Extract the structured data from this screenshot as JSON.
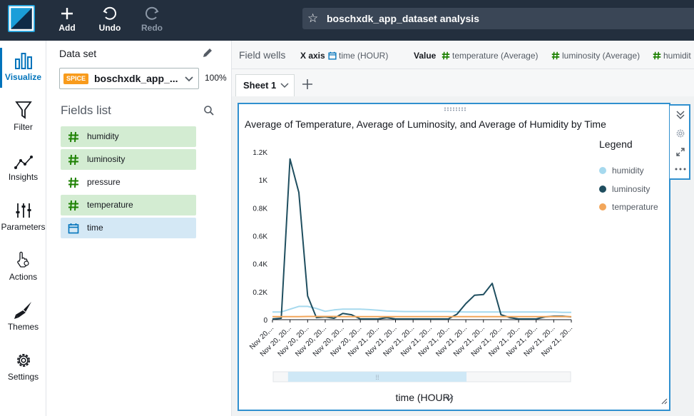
{
  "app": {
    "title": "boschxdk_app_dataset analysis",
    "toolbar": {
      "add": "Add",
      "undo": "Undo",
      "redo": "Redo"
    }
  },
  "rail": [
    {
      "label": "Visualize",
      "icon": "bar-chart-icon",
      "active": true
    },
    {
      "label": "Filter",
      "icon": "filter-icon"
    },
    {
      "label": "Insights",
      "icon": "insights-icon"
    },
    {
      "label": "Parameters",
      "icon": "sliders-icon"
    },
    {
      "label": "Actions",
      "icon": "pointer-gear-icon"
    },
    {
      "label": "Themes",
      "icon": "brush-icon"
    },
    {
      "label": "Settings",
      "icon": "gear-icon"
    }
  ],
  "panel": {
    "dataset_label": "Data set",
    "spice_badge": "SPICE",
    "dataset_name": "boschxdk_app_...",
    "dataset_pct": "100%",
    "fields_title": "Fields list",
    "fields": [
      {
        "name": "humidity",
        "type": "number",
        "selected": true
      },
      {
        "name": "luminosity",
        "type": "number",
        "selected": true
      },
      {
        "name": "pressure",
        "type": "number",
        "selected": false
      },
      {
        "name": "temperature",
        "type": "number",
        "selected": true
      },
      {
        "name": "time",
        "type": "date",
        "selected": true
      }
    ]
  },
  "wells": {
    "title": "Field wells",
    "x_label": "X axis",
    "x_value": "time (HOUR)",
    "value_label": "Value",
    "values": [
      "temperature (Average)",
      "luminosity (Average)",
      "humidit"
    ]
  },
  "sheets": {
    "active": "Sheet 1"
  },
  "visual": {
    "title": "Average of Temperature, Average of Luminosity, and Average of Humidity by Time",
    "legend_title": "Legend",
    "x_axis_title": "time (HOUR)"
  },
  "colors": {
    "topbar": "#232f3e",
    "accent": "#0073bb",
    "humidity": "#a6d9ee",
    "luminosity": "#1f4e5f",
    "temperature": "#f2a65a"
  },
  "chart_data": {
    "type": "line",
    "ylim": [
      0,
      1200
    ],
    "yticks": [
      0,
      200,
      400,
      600,
      800,
      1000,
      1200
    ],
    "ytick_labels": [
      "0",
      "0.2K",
      "0.4K",
      "0.6K",
      "0.8K",
      "1K",
      "1.2K"
    ],
    "xtick_labels": [
      "Nov 20,...",
      "Nov 20, 20...",
      "Nov 20, 20...",
      "Nov 20, 20...",
      "Nov 20, 20...",
      "Nov 20, 20...",
      "Nov 21, 20...",
      "Nov 21, 20...",
      "Nov 21, 20...",
      "Nov 21, 20...",
      "Nov 21, 20...",
      "Nov 21, 20...",
      "Nov 21, 20...",
      "Nov 21, 20...",
      "Nov 21, 20...",
      "Nov 21, 20...",
      "Nov 21, 20...",
      "Nov 21, 20..."
    ],
    "xlabel": "time (HOUR)",
    "legend": "right",
    "series": [
      {
        "name": "humidity",
        "color": "#a6d9ee",
        "values": [
          55,
          55,
          75,
          95,
          95,
          80,
          60,
          70,
          75,
          75,
          75,
          72,
          68,
          62,
          60,
          58,
          58,
          58,
          58,
          58,
          58,
          56,
          55,
          55,
          55,
          55,
          55,
          55,
          55,
          55,
          55,
          55,
          55,
          52,
          52
        ]
      },
      {
        "name": "luminosity",
        "color": "#1f4e5f",
        "values": [
          5,
          10,
          1150,
          910,
          170,
          15,
          20,
          10,
          45,
          35,
          5,
          5,
          5,
          15,
          5,
          5,
          5,
          5,
          5,
          5,
          5,
          40,
          115,
          175,
          180,
          260,
          35,
          15,
          5,
          5,
          5,
          20,
          25,
          25,
          20
        ]
      },
      {
        "name": "temperature",
        "color": "#f2a65a",
        "values": [
          22,
          22,
          22,
          22,
          23,
          23,
          23,
          23,
          22,
          22,
          22,
          22,
          22,
          22,
          22,
          22,
          22,
          22,
          22,
          22,
          22,
          22,
          22,
          22,
          22,
          22,
          22,
          22,
          22,
          22,
          22,
          22,
          22,
          22,
          22
        ]
      }
    ],
    "scroll_window": [
      0.05,
      0.65
    ]
  }
}
